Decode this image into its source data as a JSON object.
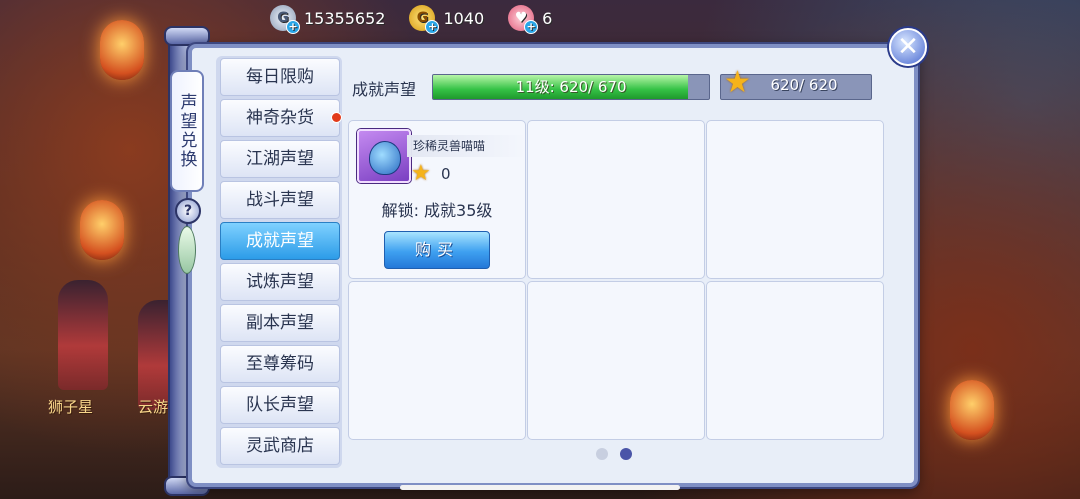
{
  "currencies": [
    {
      "icon": "silver-coin-icon",
      "glyph": "G",
      "value": "15355652"
    },
    {
      "icon": "gold-coin-icon",
      "glyph": "G",
      "value": "1040"
    },
    {
      "icon": "heart-icon",
      "glyph": "♥",
      "value": "6"
    }
  ],
  "side_tab_label": "声望兑换",
  "help_glyph": "?",
  "close_glyph": "✕",
  "menu": [
    {
      "label": "每日限购",
      "active": false,
      "badge": false
    },
    {
      "label": "神奇杂货",
      "active": false,
      "badge": true
    },
    {
      "label": "江湖声望",
      "active": false,
      "badge": false
    },
    {
      "label": "战斗声望",
      "active": false,
      "badge": false
    },
    {
      "label": "成就声望",
      "active": true,
      "badge": false
    },
    {
      "label": "试炼声望",
      "active": false,
      "badge": false
    },
    {
      "label": "副本声望",
      "active": false,
      "badge": false
    },
    {
      "label": "至尊筹码",
      "active": false,
      "badge": false
    },
    {
      "label": "队长声望",
      "active": false,
      "badge": false
    },
    {
      "label": "灵武商店",
      "active": false,
      "badge": false
    }
  ],
  "reputation": {
    "label": "成就声望",
    "progress_text": "11级: 620/ 670",
    "progress_fraction": 0.925,
    "star_text": "620/ 620",
    "star_glyph": "★"
  },
  "item": {
    "name": "珍稀灵兽喵喵",
    "star_glyph": "★",
    "cost": "0",
    "unlock": "解锁: 成就35级",
    "buy_label": "购买"
  },
  "pagination": {
    "total": 2,
    "current": 2
  },
  "npcs": [
    "狮子星",
    "云游"
  ],
  "colors": {
    "accent": "#2c9ce8",
    "progress": "#35c246",
    "star": "#f5b31a"
  }
}
